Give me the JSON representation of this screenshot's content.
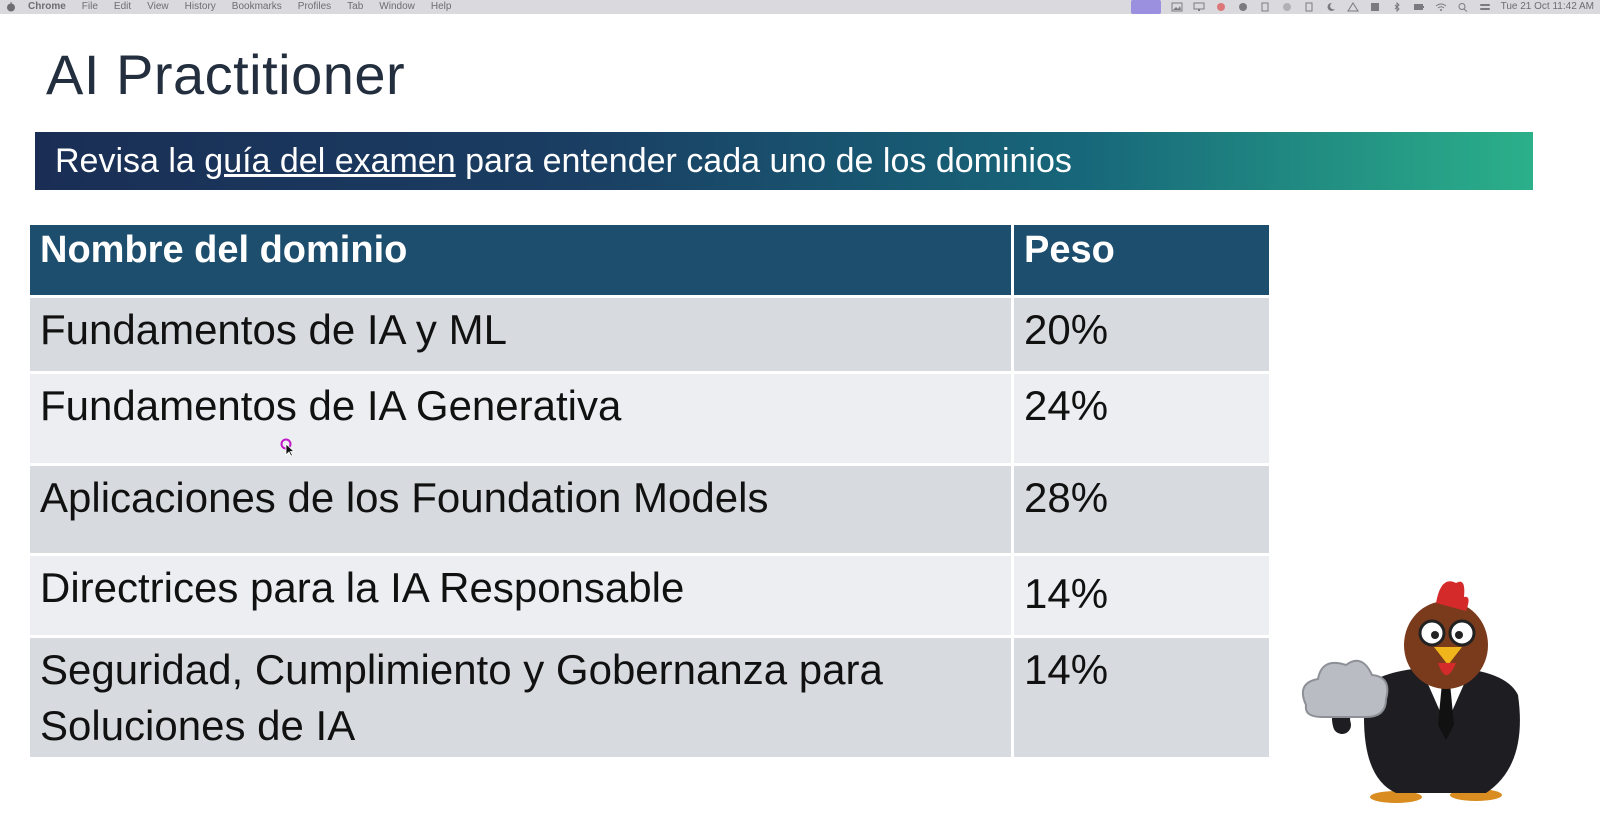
{
  "menubar": {
    "app": "Chrome",
    "items": [
      "File",
      "Edit",
      "View",
      "History",
      "Bookmarks",
      "Profiles",
      "Tab",
      "Window",
      "Help"
    ],
    "clock": "Tue 21 Oct  11:42 AM"
  },
  "slide": {
    "title": "AI Practitioner",
    "banner": {
      "before": "Revisa la ",
      "link": "guía del examen",
      "after": " para entender cada uno de los dominios"
    },
    "table": {
      "headers": [
        "Nombre del dominio",
        "Peso"
      ],
      "rows": [
        {
          "name": "Fundamentos de IA y ML",
          "weight": "20%"
        },
        {
          "name": "Fundamentos de IA Generativa",
          "weight": "24%"
        },
        {
          "name": "Aplicaciones de los Foundation Models",
          "weight": "28%"
        },
        {
          "name": "Directrices para la IA Responsable",
          "weight": "14%"
        },
        {
          "name": "Seguridad, Cumplimiento y Gobernanza para Soluciones de IA",
          "weight": "14%"
        }
      ]
    }
  },
  "colors": {
    "header_bg": "#1d4e6e",
    "row_odd": "#d7dbe0",
    "row_even": "#eceef1",
    "banner_start": "#1a2e55",
    "banner_end": "#2bb08a"
  },
  "icons": {
    "mascot": "rooster-businessman-with-cloud-icon",
    "cursor": "mouse-pointer-icon"
  }
}
